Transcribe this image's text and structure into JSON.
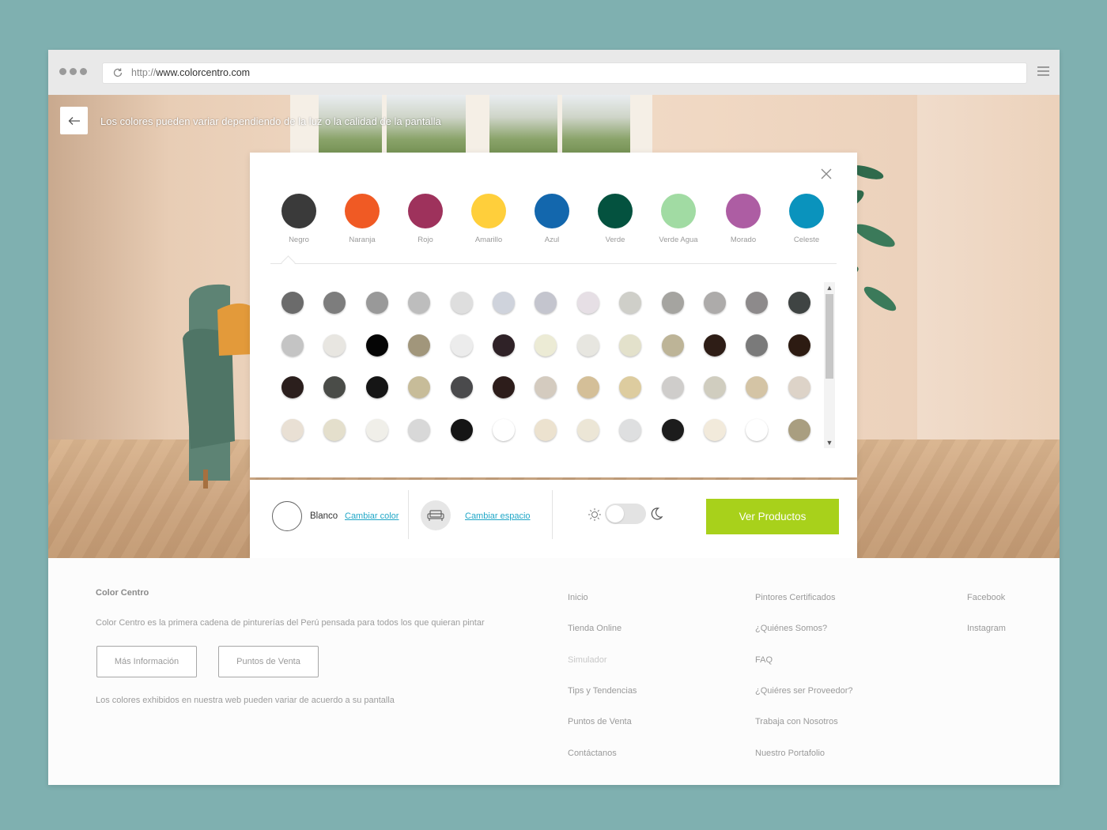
{
  "browser": {
    "url_protocol": "http://",
    "url_host": "www.colorcentro.com"
  },
  "hero": {
    "note": "Los colores pueden variar dependiendo de la luz o la calidad de la pantalla"
  },
  "families": [
    {
      "label": "Negro",
      "color": "#3a3a3a"
    },
    {
      "label": "Naranja",
      "color": "#f05a24"
    },
    {
      "label": "Rojo",
      "color": "#9e325c"
    },
    {
      "label": "Amarillo",
      "color": "#ffcf3b"
    },
    {
      "label": "Azul",
      "color": "#1367ad"
    },
    {
      "label": "Verde",
      "color": "#04523f"
    },
    {
      "label": "Verde Agua",
      "color": "#a1dba3"
    },
    {
      "label": "Morado",
      "color": "#ad5da3"
    },
    {
      "label": "Celeste",
      "color": "#0a93bd"
    }
  ],
  "swatches": [
    [
      "#6b6b6b",
      "#7d7d7d",
      "#999999",
      "#bdbdbd",
      "#dedede",
      "#cfd3dc",
      "#c4c5ce",
      "#e6dfe5",
      "#cfcfc9",
      "#a5a4a0",
      "#adabaa",
      "#8d8a8b",
      "#3f4443"
    ],
    [
      "#c4c4c4",
      "#e8e6e1",
      "#050505",
      "#a1967b",
      "#ececec",
      "#2f2227",
      "#ecebd5",
      "#e7e6e0",
      "#e3e1cb",
      "#bdb497",
      "#2e1d16",
      "#7a7a7a",
      "#2d1b12"
    ],
    [
      "#2b1f1d",
      "#4a4c48",
      "#151515",
      "#c7bc99",
      "#4a4a4c",
      "#2d1d1b",
      "#d4cbbf",
      "#d4bf98",
      "#ddcc9f",
      "#cfcdcb",
      "#d0cdbf",
      "#d4c4a5",
      "#ddd3c8"
    ],
    [
      "#e9e0d4",
      "#e4dfcc",
      "#f0efe9",
      "#d8d8d8",
      "#151515",
      "#ffffff",
      "#ece2cf",
      "#ece6d6",
      "#dedfe0",
      "#1c1c1c",
      "#f2eadb",
      "#ffffff",
      "#a99e80"
    ]
  ],
  "selection": {
    "name": "Blanco",
    "color": "#ffffff",
    "change_color": "Cambiar color",
    "change_space": "Cambiar espacio",
    "cta": "Ver Productos",
    "accent": "#a8d11b"
  },
  "footer": {
    "brand": "Color Centro",
    "description": "Color Centro es la primera cadena de pinturerías del Perú pensada para todos los que quieran pintar",
    "btn_more": "Más Información",
    "btn_points": "Puntos de Venta",
    "note": "Los colores exhibidos en nuestra web pueden variar de acuerdo a su pantalla",
    "col1": [
      "Inicio",
      "Tienda Online",
      "Simulador",
      "Tips y Tendencias",
      "Puntos de Venta",
      "Contáctanos"
    ],
    "col2": [
      "Pintores Certificados",
      "¿Quiénes Somos?",
      "FAQ",
      "¿Quiéres ser Proveedor?",
      "Trabaja con Nosotros",
      "Nuestro Portafolio"
    ],
    "col3": [
      "Facebook",
      "Instagram"
    ]
  }
}
